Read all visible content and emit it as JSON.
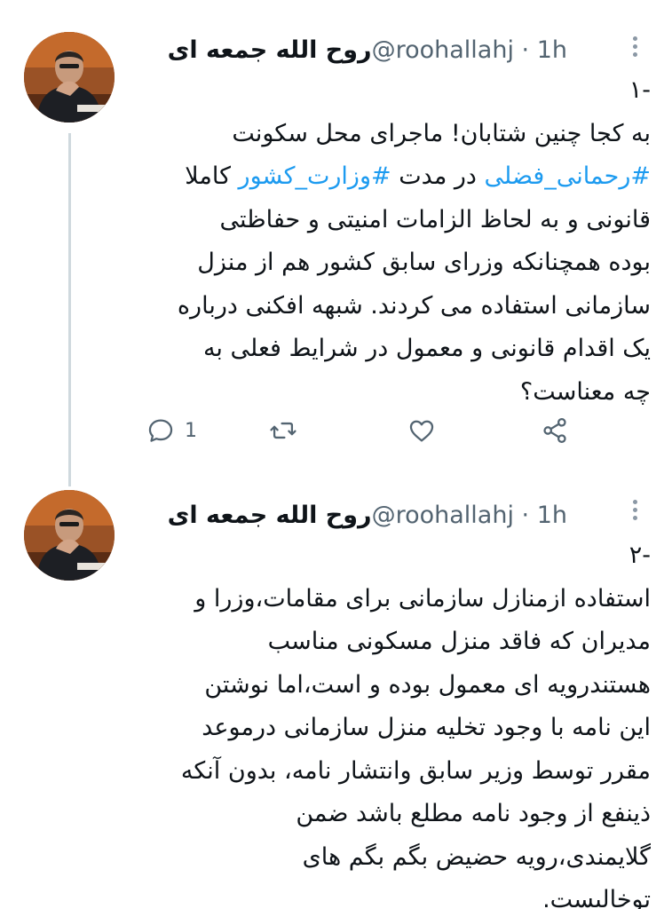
{
  "colors": {
    "text": "#0f1419",
    "secondary": "#536471",
    "hashtag": "#1d9bf0",
    "thread_line": "#cfd9de"
  },
  "tweets": [
    {
      "display_name": "روح الله جمعه ای",
      "meta": "@roohallahj · 1h",
      "lines": [
        [
          "-۱"
        ],
        [
          "به کجا چنین شتابان! ماجرای محل سکونت"
        ],
        [
          "#رحمانی_فضلی",
          " در مدت ",
          "#وزارت_کشور",
          " کاملا"
        ],
        [
          "قانونی و به لحاظ الزامات امنیتی و حفاظتی"
        ],
        [
          "بوده همچنانکه وزرای سابق کشور هم از منزل"
        ],
        [
          "سازمانی استفاده می کردند. شبهه افکنی درباره"
        ],
        [
          "یک اقدام قانونی و معمول در شرایط فعلی به"
        ],
        [
          "چه معناست؟"
        ]
      ],
      "actions": {
        "reply_count": "1"
      },
      "icons": [
        "reply-icon",
        "retweet-icon",
        "like-icon",
        "share-icon",
        "more-icon"
      ]
    },
    {
      "display_name": "روح الله جمعه ای",
      "meta": "@roohallahj · 1h",
      "lines": [
        [
          "-۲"
        ],
        [
          "استفاده ازمنازل سازمانی برای مقامات،وزرا و"
        ],
        [
          "مدیران که فاقد منزل مسکونی مناسب"
        ],
        [
          "هستندرویه ای معمول بوده و است،اما نوشتن"
        ],
        [
          "این نامه با وجود تخلیه منزل سازمانی درموعد"
        ],
        [
          "مقرر توسط وزیر سابق وانتشار نامه، بدون آنکه"
        ],
        [
          "ذینفع از وجود نامه مطلع باشد ضمن"
        ],
        [
          "گلایمندی،رویه حضیض بگم بگم های"
        ],
        [
          "توخالیست."
        ]
      ]
    }
  ]
}
